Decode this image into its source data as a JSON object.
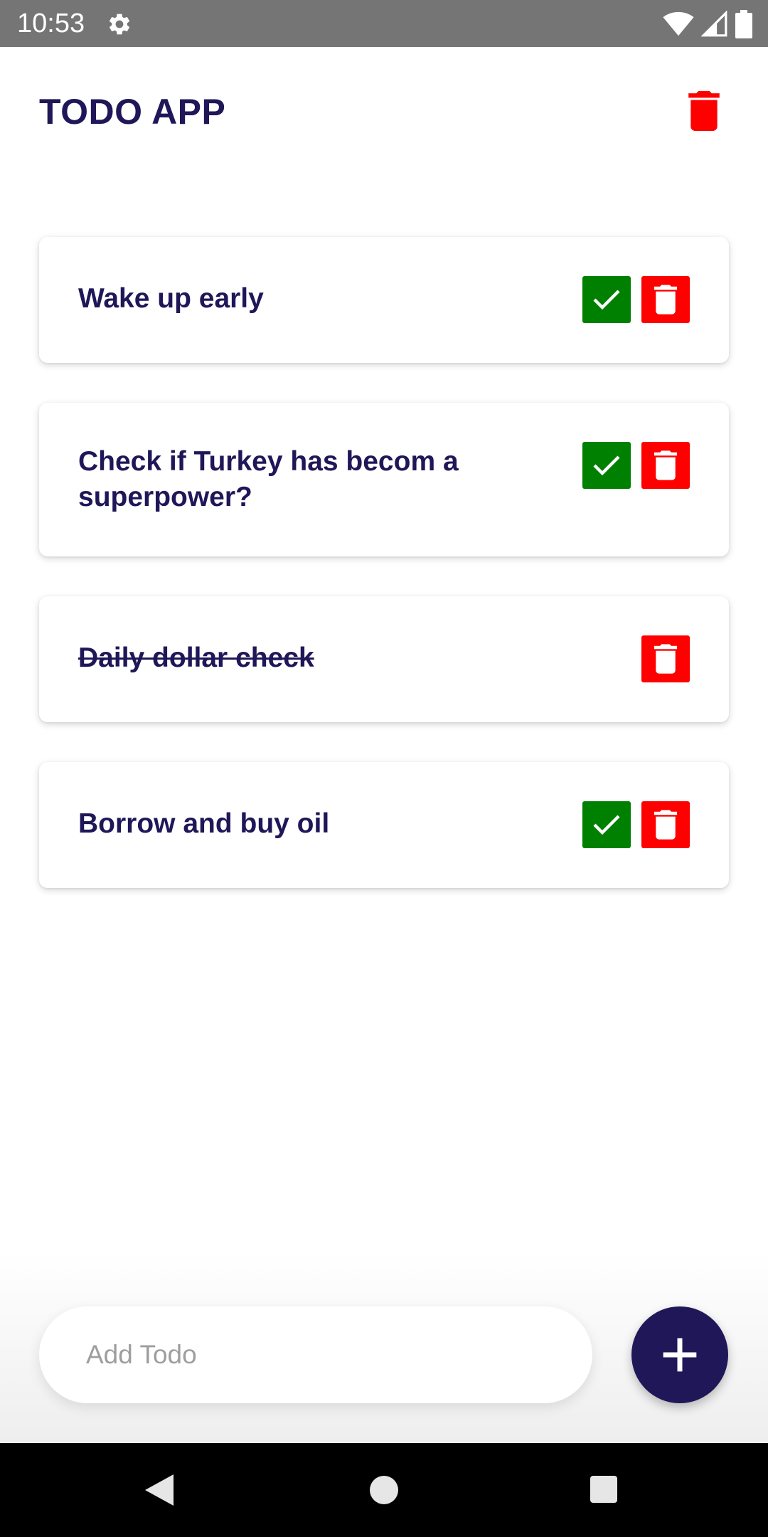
{
  "status_bar": {
    "time": "10:53",
    "icons": [
      "gear-icon",
      "wifi-icon",
      "signal-icon",
      "battery-icon"
    ]
  },
  "header": {
    "title": "TODO APP",
    "delete_all_icon": "trash-icon"
  },
  "todos": [
    {
      "text": "Wake up early",
      "completed": false
    },
    {
      "text": "Check if Turkey has becom a superpower?",
      "completed": false
    },
    {
      "text": "Daily dollar check",
      "completed": true
    },
    {
      "text": "Borrow and buy oil",
      "completed": false
    }
  ],
  "add_todo": {
    "placeholder": "Add Todo",
    "value": "",
    "button_icon": "plus-icon"
  },
  "navigation": {
    "icons": [
      "back-icon",
      "home-icon",
      "recents-icon"
    ]
  },
  "colors": {
    "primary": "#1f1758",
    "check": "#008000",
    "delete": "#ff0000",
    "status_bar": "#757575"
  }
}
